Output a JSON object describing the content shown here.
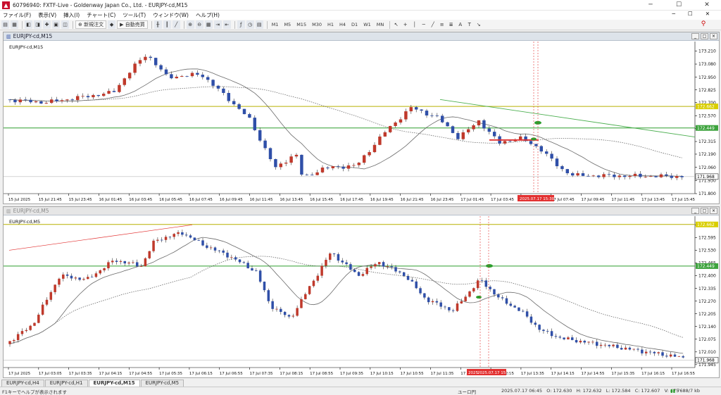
{
  "window": {
    "title": "60796940: FXTF-Live - Goldenway Japan Co., Ltd. - EURJPY-cd,M15",
    "app_icon": "metatrader-icon",
    "minimize": "─",
    "maximize": "☐",
    "close": "✕"
  },
  "menu": {
    "items": [
      "ファイル(F)",
      "表示(V)",
      "挿入(I)",
      "チャート(C)",
      "ツール(T)",
      "ウィンドウ(W)",
      "ヘルプ(H)"
    ],
    "right": [
      "─",
      "☐",
      "✕"
    ]
  },
  "toolbar": {
    "new_order": "新規注文",
    "auto_trade": "自動売買",
    "timeframes": [
      "M1",
      "M5",
      "M15",
      "M30",
      "H1",
      "H4",
      "D1",
      "W1",
      "MN"
    ]
  },
  "top_chart": {
    "title": "EURJPY-cd,M15",
    "inner_label": "EURJPY-cd,M15",
    "price_ticks": [
      "173.210",
      "173.080",
      "172.950",
      "172.825",
      "172.700",
      "172.570",
      "172.445",
      "172.315",
      "172.190",
      "172.060",
      "171.930",
      "171.800"
    ],
    "time_ticks": [
      "15 Jul 2025",
      "15 Jul 21:45",
      "15 Jul 23:45",
      "16 Jul 01:45",
      "16 Jul 03:45",
      "16 Jul 05:45",
      "16 Jul 07:45",
      "16 Jul 09:45",
      "16 Jul 11:45",
      "16 Jul 13:45",
      "16 Jul 15:45",
      "16 Jul 17:45",
      "16 Jul 19:45",
      "16 Jul 21:45",
      "16 Jul 23:45",
      "17 Jul 01:45",
      "17 Jul 03:45",
      "17 Jul 05:45",
      "17 Jul 07:45",
      "17 Jul 09:45",
      "17 Jul 11:45",
      "17 Jul 13:45",
      "17 Jul 15:45"
    ],
    "level_upper": "172.662",
    "level_lower": "172.449",
    "current_price": "171.968",
    "cursor_time": "2025.07.17 15:30",
    "ylim": [
      171.8,
      173.275
    ],
    "bars": 130
  },
  "bottom_chart": {
    "title": "EURJPY-cd,M5",
    "inner_label": "EURJPY-cd,M5",
    "price_ticks": [
      "172.660",
      "172.595",
      "172.530",
      "172.465",
      "172.400",
      "172.335",
      "172.270",
      "172.205",
      "172.140",
      "172.075",
      "172.010",
      "171.945"
    ],
    "time_ticks": [
      "17 Jul 2025",
      "17 Jul 03:05",
      "17 Jul 03:35",
      "17 Jul 04:15",
      "17 Jul 04:55",
      "17 Jul 05:35",
      "17 Jul 06:15",
      "17 Jul 06:55",
      "17 Jul 07:35",
      "17 Jul 08:15",
      "17 Jul 08:55",
      "17 Jul 09:35",
      "17 Jul 10:15",
      "17 Jul 10:55",
      "17 Jul 11:35",
      "17 Jul 12:15",
      "17 Jul 12:55",
      "17 Jul 13:35",
      "17 Jul 14:15",
      "17 Jul 14:55",
      "17 Jul 15:35",
      "17 Jul 16:15",
      "17 Jul 16:55"
    ],
    "level_upper": "172.662",
    "level_lower": "172.449",
    "current_price": "171.968",
    "cursor_time_a": "2025",
    "cursor_time_b": "2025.07.17 15:30",
    "ylim": [
      171.93,
      172.69
    ],
    "bars": 165
  },
  "colors": {
    "bull": "#c0392b",
    "bear": "#2f4fa8",
    "level_upper": "#b8b000",
    "level_lower": "#2e9e2e",
    "trendline": "#4caf50",
    "redline": "#e23030",
    "ma_solid": "#6a6a6a",
    "ma_dotted": "#6a6a6a",
    "price_label_bg": "#d9ce00",
    "price_label_green": "#3da33d"
  },
  "tabs": [
    "EURJPY-cd,H4",
    "EURJPY-cd,H1",
    "EURJPY-cd,M15",
    "EURJPY-cd,M5"
  ],
  "status": {
    "help": "F1キーでヘルプが表示されます",
    "profile": "ユーロ円",
    "datetime": "2025.07.17 06:45",
    "open": "O: 172.630",
    "high": "H: 172.632",
    "low": "L: 172.584",
    "close": "C: 172.607",
    "volume": "V: 475",
    "traffic": "7688/7 kb"
  }
}
